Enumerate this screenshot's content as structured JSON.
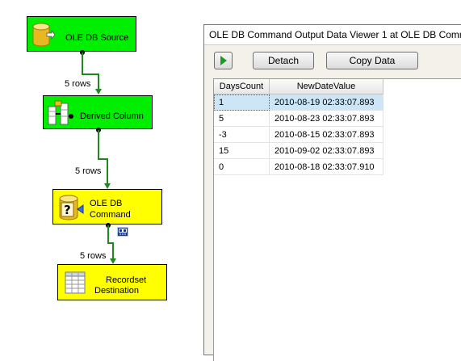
{
  "dataflow": {
    "tasks": [
      {
        "label": "OLE DB Source",
        "icon": "database-cylinder-icon"
      },
      {
        "label": "Derived Column",
        "icon": "derived-column-icon"
      },
      {
        "label_line1": "OLE DB",
        "label_line2": "Command",
        "icon": "question-database-icon"
      },
      {
        "label_line1": "Recordset",
        "label_line2": "Destination",
        "icon": "recordset-grid-icon"
      }
    ],
    "paths": [
      {
        "rows": "5 rows"
      },
      {
        "rows": "5 rows"
      },
      {
        "rows": "5 rows"
      }
    ],
    "colors": {
      "valid": "#00ee00",
      "executing": "#ffff00",
      "path": "#1e8a1e"
    }
  },
  "viewer": {
    "title": "OLE DB Command Output Data Viewer 1 at OLE DB Comm",
    "buttons": {
      "play_icon": "play-icon",
      "detach": "Detach",
      "copy": "Copy Data"
    },
    "columns": [
      "DaysCount",
      "NewDateValue"
    ],
    "rows": [
      [
        "1",
        "2010-08-19 02:33:07.893"
      ],
      [
        "5",
        "2010-08-23 02:33:07.893"
      ],
      [
        "-3",
        "2010-08-15 02:33:07.893"
      ],
      [
        "15",
        "2010-09-02 02:33:07.893"
      ],
      [
        "0",
        "2010-08-18 02:33:07.910"
      ]
    ],
    "selected_row": 0
  }
}
